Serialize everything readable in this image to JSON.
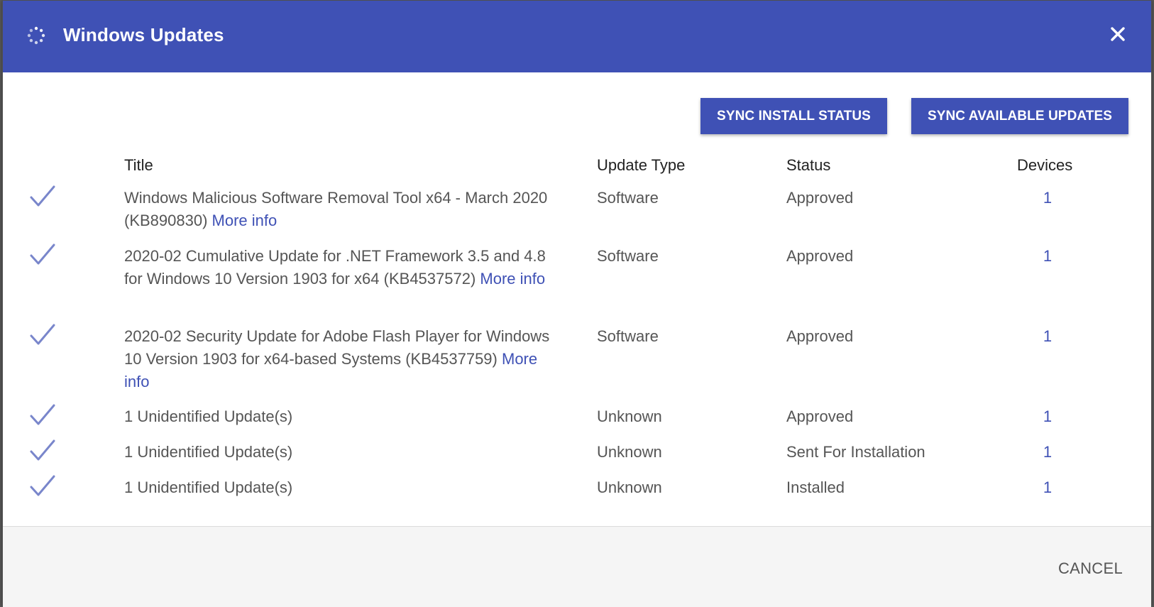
{
  "dialog": {
    "title": "Windows Updates",
    "icons": {
      "header": "loading-spinner-icon",
      "close": "close-icon",
      "row": "check-icon"
    },
    "colors": {
      "primary": "#3f51b5",
      "text": "#555555",
      "heading": "#222222",
      "check": "#7986cb"
    }
  },
  "toolbar": {
    "sync_install_label": "SYNC INSTALL STATUS",
    "sync_available_label": "SYNC AVAILABLE UPDATES"
  },
  "table": {
    "columns": [
      "Title",
      "Update Type",
      "Status",
      "Devices"
    ],
    "more_info_label": "More info",
    "rows": [
      {
        "title": "Windows Malicious Software Removal Tool x64 - March 2020 (KB890830)",
        "has_more_info": true,
        "type": "Software",
        "status": "Approved",
        "devices": "1"
      },
      {
        "title": "2020-02 Cumulative Update for .NET Framework 3.5 and 4.8 for Windows 10 Version 1903 for x64 (KB4537572)",
        "has_more_info": true,
        "type": "Software",
        "status": "Approved",
        "devices": "1"
      },
      {
        "title": "2020-02 Security Update for Adobe Flash Player for Windows 10 Version 1903 for x64-based Systems (KB4537759)",
        "has_more_info": true,
        "type": "Software",
        "status": "Approved",
        "devices": "1"
      },
      {
        "title": "1 Unidentified Update(s)",
        "has_more_info": false,
        "type": "Unknown",
        "status": "Approved",
        "devices": "1"
      },
      {
        "title": "1 Unidentified Update(s)",
        "has_more_info": false,
        "type": "Unknown",
        "status": "Sent For Installation",
        "devices": "1"
      },
      {
        "title": "1 Unidentified Update(s)",
        "has_more_info": false,
        "type": "Unknown",
        "status": "Installed",
        "devices": "1"
      }
    ]
  },
  "footer": {
    "cancel_label": "CANCEL"
  }
}
